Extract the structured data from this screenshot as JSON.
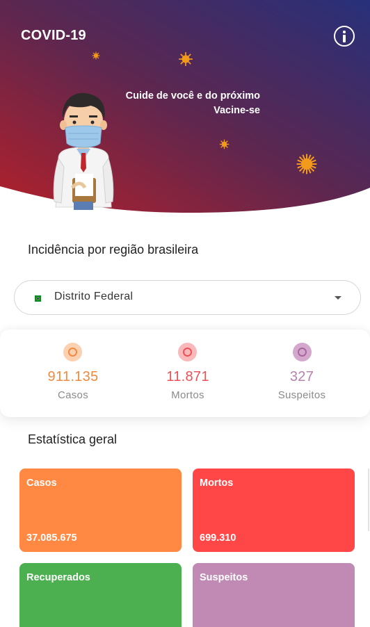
{
  "header": {
    "title": "COVID-19",
    "slogan_line1": "Cuide de você e do próximo",
    "slogan_line2": "Vacine-se",
    "gradient_colors": [
      "#b0202a",
      "#5c2750",
      "#2a2f6e"
    ]
  },
  "icons": {
    "info": "info-icon",
    "virus": "virus-icon",
    "flag": "brazil-flag-icon",
    "dropdown": "caret-down-icon"
  },
  "region": {
    "title": "Incidência por região brasileira",
    "selected": "Distrito Federal"
  },
  "regional_stats": [
    {
      "value": "911.135",
      "label": "Casos",
      "color": "#f2893f",
      "icon_bg": "#fcd1b2"
    },
    {
      "value": "11.871",
      "label": "Mortos",
      "color": "#ee4f56",
      "icon_bg": "#f9b9bb"
    },
    {
      "value": "327",
      "label": "Suspeitos",
      "color": "#b780ad",
      "icon_bg": "#d4a8cc"
    }
  ],
  "general": {
    "title": "Estatística geral",
    "tiles": [
      {
        "label": "Casos",
        "value": "37.085.675",
        "color": "#ff8843"
      },
      {
        "label": "Mortos",
        "value": "699.310",
        "color": "#ff4747"
      },
      {
        "label": "Recuperados",
        "value": "",
        "color": "#4caf50"
      },
      {
        "label": "Suspeitos",
        "value": "",
        "color": "#c08ab4"
      }
    ]
  }
}
